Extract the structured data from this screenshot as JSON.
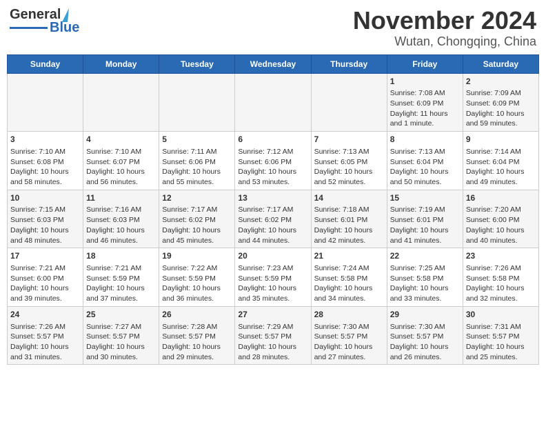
{
  "header": {
    "logo_general": "General",
    "logo_blue": "Blue",
    "month_title": "November 2024",
    "location": "Wutan, Chongqing, China"
  },
  "days_of_week": [
    "Sunday",
    "Monday",
    "Tuesday",
    "Wednesday",
    "Thursday",
    "Friday",
    "Saturday"
  ],
  "weeks": [
    [
      {
        "day": "",
        "content": ""
      },
      {
        "day": "",
        "content": ""
      },
      {
        "day": "",
        "content": ""
      },
      {
        "day": "",
        "content": ""
      },
      {
        "day": "",
        "content": ""
      },
      {
        "day": "1",
        "content": "Sunrise: 7:08 AM\nSunset: 6:09 PM\nDaylight: 11 hours and 1 minute."
      },
      {
        "day": "2",
        "content": "Sunrise: 7:09 AM\nSunset: 6:09 PM\nDaylight: 10 hours and 59 minutes."
      }
    ],
    [
      {
        "day": "3",
        "content": "Sunrise: 7:10 AM\nSunset: 6:08 PM\nDaylight: 10 hours and 58 minutes."
      },
      {
        "day": "4",
        "content": "Sunrise: 7:10 AM\nSunset: 6:07 PM\nDaylight: 10 hours and 56 minutes."
      },
      {
        "day": "5",
        "content": "Sunrise: 7:11 AM\nSunset: 6:06 PM\nDaylight: 10 hours and 55 minutes."
      },
      {
        "day": "6",
        "content": "Sunrise: 7:12 AM\nSunset: 6:06 PM\nDaylight: 10 hours and 53 minutes."
      },
      {
        "day": "7",
        "content": "Sunrise: 7:13 AM\nSunset: 6:05 PM\nDaylight: 10 hours and 52 minutes."
      },
      {
        "day": "8",
        "content": "Sunrise: 7:13 AM\nSunset: 6:04 PM\nDaylight: 10 hours and 50 minutes."
      },
      {
        "day": "9",
        "content": "Sunrise: 7:14 AM\nSunset: 6:04 PM\nDaylight: 10 hours and 49 minutes."
      }
    ],
    [
      {
        "day": "10",
        "content": "Sunrise: 7:15 AM\nSunset: 6:03 PM\nDaylight: 10 hours and 48 minutes."
      },
      {
        "day": "11",
        "content": "Sunrise: 7:16 AM\nSunset: 6:03 PM\nDaylight: 10 hours and 46 minutes."
      },
      {
        "day": "12",
        "content": "Sunrise: 7:17 AM\nSunset: 6:02 PM\nDaylight: 10 hours and 45 minutes."
      },
      {
        "day": "13",
        "content": "Sunrise: 7:17 AM\nSunset: 6:02 PM\nDaylight: 10 hours and 44 minutes."
      },
      {
        "day": "14",
        "content": "Sunrise: 7:18 AM\nSunset: 6:01 PM\nDaylight: 10 hours and 42 minutes."
      },
      {
        "day": "15",
        "content": "Sunrise: 7:19 AM\nSunset: 6:01 PM\nDaylight: 10 hours and 41 minutes."
      },
      {
        "day": "16",
        "content": "Sunrise: 7:20 AM\nSunset: 6:00 PM\nDaylight: 10 hours and 40 minutes."
      }
    ],
    [
      {
        "day": "17",
        "content": "Sunrise: 7:21 AM\nSunset: 6:00 PM\nDaylight: 10 hours and 39 minutes."
      },
      {
        "day": "18",
        "content": "Sunrise: 7:21 AM\nSunset: 5:59 PM\nDaylight: 10 hours and 37 minutes."
      },
      {
        "day": "19",
        "content": "Sunrise: 7:22 AM\nSunset: 5:59 PM\nDaylight: 10 hours and 36 minutes."
      },
      {
        "day": "20",
        "content": "Sunrise: 7:23 AM\nSunset: 5:59 PM\nDaylight: 10 hours and 35 minutes."
      },
      {
        "day": "21",
        "content": "Sunrise: 7:24 AM\nSunset: 5:58 PM\nDaylight: 10 hours and 34 minutes."
      },
      {
        "day": "22",
        "content": "Sunrise: 7:25 AM\nSunset: 5:58 PM\nDaylight: 10 hours and 33 minutes."
      },
      {
        "day": "23",
        "content": "Sunrise: 7:26 AM\nSunset: 5:58 PM\nDaylight: 10 hours and 32 minutes."
      }
    ],
    [
      {
        "day": "24",
        "content": "Sunrise: 7:26 AM\nSunset: 5:57 PM\nDaylight: 10 hours and 31 minutes."
      },
      {
        "day": "25",
        "content": "Sunrise: 7:27 AM\nSunset: 5:57 PM\nDaylight: 10 hours and 30 minutes."
      },
      {
        "day": "26",
        "content": "Sunrise: 7:28 AM\nSunset: 5:57 PM\nDaylight: 10 hours and 29 minutes."
      },
      {
        "day": "27",
        "content": "Sunrise: 7:29 AM\nSunset: 5:57 PM\nDaylight: 10 hours and 28 minutes."
      },
      {
        "day": "28",
        "content": "Sunrise: 7:30 AM\nSunset: 5:57 PM\nDaylight: 10 hours and 27 minutes."
      },
      {
        "day": "29",
        "content": "Sunrise: 7:30 AM\nSunset: 5:57 PM\nDaylight: 10 hours and 26 minutes."
      },
      {
        "day": "30",
        "content": "Sunrise: 7:31 AM\nSunset: 5:57 PM\nDaylight: 10 hours and 25 minutes."
      }
    ]
  ]
}
